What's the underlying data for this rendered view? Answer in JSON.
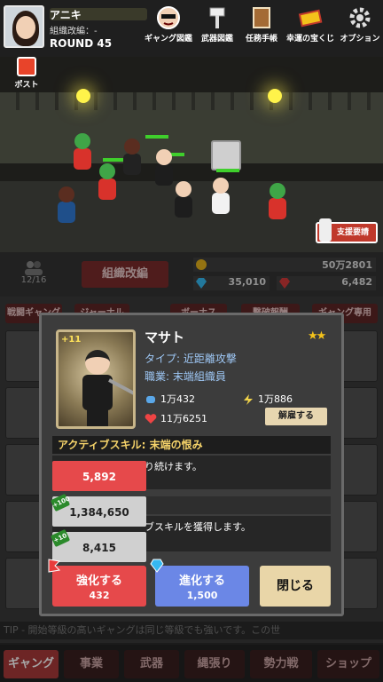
{
  "header": {
    "player_name": "アニキ",
    "squad_label": "組織改編：-",
    "round_label": "ROUND 45"
  },
  "menu": [
    {
      "label": "ギャング図鑑",
      "icon": "face-icon"
    },
    {
      "label": "武器図鑑",
      "icon": "hammer-icon"
    },
    {
      "label": "任務手帳",
      "icon": "notebook-icon"
    },
    {
      "label": "幸運の宝くじ",
      "icon": "ticket-icon"
    },
    {
      "label": "オプション",
      "icon": "gear-icon"
    }
  ],
  "post_label": "ポスト",
  "support_label": "支援要請",
  "status": {
    "members": "12/16",
    "org_button": "組織改編",
    "gold": "50万2801",
    "gems": "35,010",
    "rubies": "6,482"
  },
  "list_tabs": [
    "戦闘ギャング",
    "ジャーナル",
    "ボーナス",
    "撃破報酬",
    "ギャング専用"
  ],
  "tip": "TIP - 開始等級の高いギャングは同じ等級でも強いです。この世",
  "bottom_nav": [
    "ギャング",
    "事業",
    "武器",
    "縄張り",
    "勢力戦",
    "ショップ"
  ],
  "modal": {
    "level_badge": "+11",
    "name": "マサト",
    "stars": "★★",
    "type": "タイプ: 近距離攻撃",
    "job": "職業: 末端組織員",
    "attack": "1万432",
    "speed": "1万886",
    "hp": "11万6251",
    "dismiss": "解雇する",
    "skill_title": "アクティブスキル: 末端の恨み",
    "skill_line1": "り続けます。",
    "skill_line2": "ブスキルを獲得します。",
    "costs": [
      {
        "value": "5,892",
        "color": "#e6494b",
        "tag": ""
      },
      {
        "value": "1,384,650",
        "color": "#d0d0d0",
        "tag": "+100"
      },
      {
        "value": "8,415",
        "color": "#d0d0d0",
        "tag": "+10"
      }
    ],
    "upgrade_label": "強化する",
    "upgrade_cost": "432",
    "evolve_label": "進化する",
    "evolve_cost": "1,500",
    "close_label": "閉じる"
  }
}
